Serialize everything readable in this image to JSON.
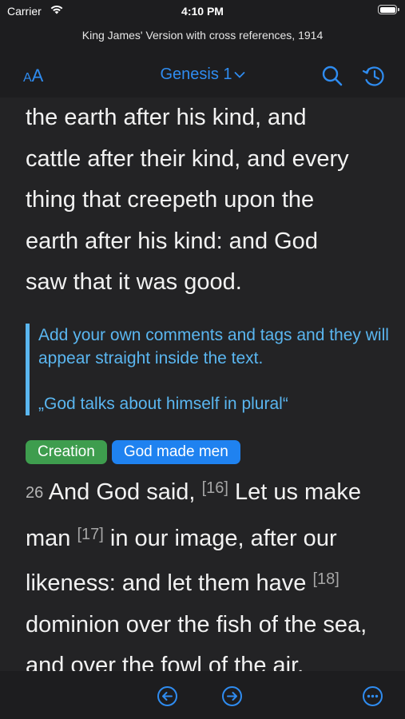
{
  "status_bar": {
    "carrier": "Carrier",
    "time": "4:10 PM"
  },
  "header": {
    "translation_title": "King James' Version with cross references, 1914"
  },
  "navbar": {
    "font_small": "A",
    "font_big": "A",
    "chapter_title": "Genesis 1"
  },
  "passage": {
    "lines_before": [
      "the earth after his kind, and",
      "cattle after their kind, and every",
      "thing that creepeth upon the",
      "earth after his kind: and God",
      "saw that it was good."
    ],
    "comment": {
      "hint": "Add your own comments and tags and they will appear straight inside the text.",
      "quote": "„God talks about himself in plural“"
    },
    "tags": [
      "Creation",
      "God made men"
    ],
    "verse_26": {
      "number": "26",
      "part1": " And God said, ",
      "ref16": "[16]",
      "part2": " Let us make man ",
      "ref17": "[17]",
      "part3": " in our image, after our likeness: and let them have ",
      "ref18": "[18]",
      "part4": " dominion over the fish of the sea, and over the fowl of the air,"
    }
  },
  "colors": {
    "accent": "#2f8cf0",
    "comment": "#5ab6f0",
    "tag_green": "#3e9d4e",
    "tag_blue": "#1f82f0",
    "background": "#232325",
    "bars": "#1d1d1f"
  },
  "icons": {
    "search": "search-icon",
    "history": "history-icon",
    "prev": "arrow-left-circle-icon",
    "next": "arrow-right-circle-icon",
    "more": "ellipsis-circle-icon"
  }
}
